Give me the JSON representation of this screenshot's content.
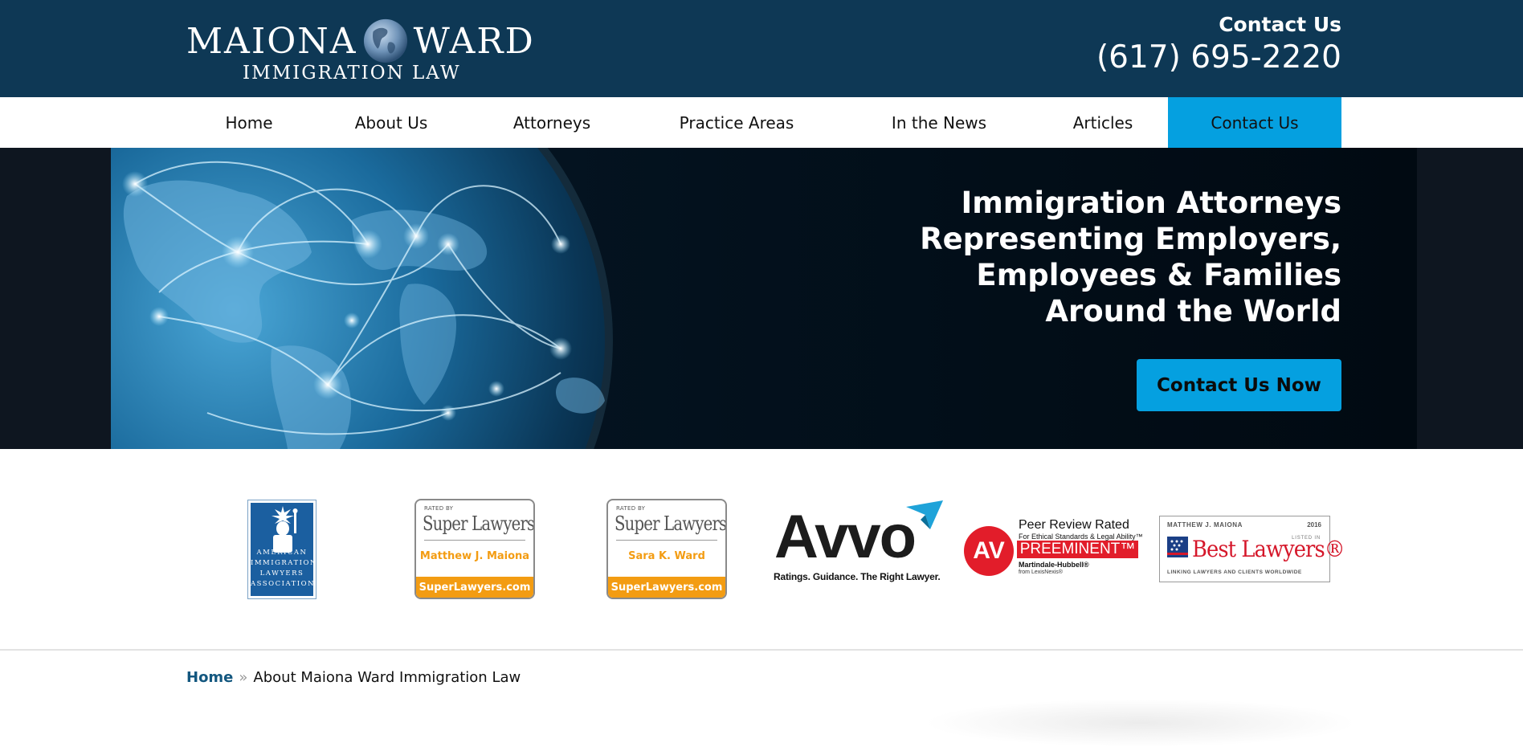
{
  "header": {
    "logo_left": "MAIONA",
    "logo_right": "WARD",
    "logo_subtitle": "IMMIGRATION LAW",
    "contact_label": "Contact Us",
    "phone": "(617) 695-2220",
    "colors": {
      "background": "#0e3855",
      "text": "#ffffff"
    }
  },
  "nav": {
    "items": [
      {
        "label": "Home"
      },
      {
        "label": "About Us"
      },
      {
        "label": "Attorneys"
      },
      {
        "label": "Practice Areas"
      },
      {
        "label": "In the News"
      },
      {
        "label": "Articles"
      },
      {
        "label": "Contact Us",
        "active": true
      }
    ],
    "active_color": "#05a0e0"
  },
  "hero": {
    "heading_lines": [
      "Immigration Attorneys ",
      "Representing Employers,",
      "Employees & Families",
      "Around the World"
    ],
    "cta_label": "Contact Us Now",
    "image_icon": "glowing-globe-network"
  },
  "badges": {
    "aila": {
      "lines": [
        "AMERICAN",
        "IMMIGRATION",
        "LAWYERS",
        "ASSOCIATION"
      ]
    },
    "super_lawyers": [
      {
        "rated_by": "RATED BY",
        "brand": "Super Lawyers",
        "name": "Matthew J. Maiona",
        "site": "SuperLawyers.com"
      },
      {
        "rated_by": "RATED BY",
        "brand": "Super Lawyers",
        "name": "Sara K. Ward",
        "site": "SuperLawyers.com"
      }
    ],
    "avvo": {
      "word": "Avvo",
      "tagline": "Ratings. Guidance. The Right Lawyer."
    },
    "martindale": {
      "av": "AV",
      "peer": "Peer Review Rated",
      "ethic": "For Ethical Standards & Legal Ability™",
      "preeminent": "PREEMINENT™",
      "martindale": "Martindale-Hubbell®",
      "lexis": "from LexisNexis®"
    },
    "best_lawyers": {
      "name": "MATTHEW J. MAIONA",
      "year": "2016",
      "listed": "LISTED IN",
      "word": "Best Lawyers®",
      "footer": "LINKING LAWYERS AND CLIENTS WORLDWIDE"
    }
  },
  "breadcrumb": {
    "home": "Home",
    "separator": "»",
    "current": "About Maiona Ward Immigration Law"
  }
}
